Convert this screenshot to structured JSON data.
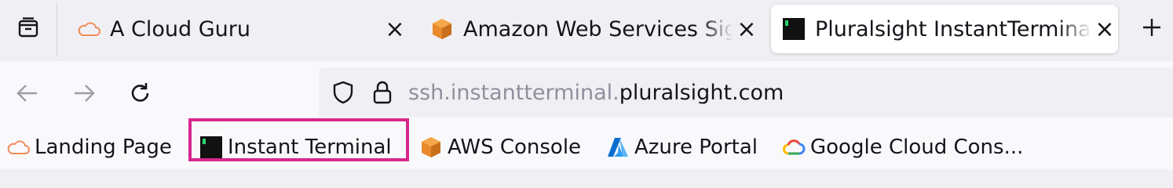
{
  "tabs": [
    {
      "title": "A Cloud Guru",
      "favicon": "cloud-icon",
      "active": false
    },
    {
      "title": "Amazon Web Services Sign-In",
      "favicon": "aws-cube-icon",
      "active": false
    },
    {
      "title": "Pluralsight InstantTerminal",
      "favicon": "terminal-icon",
      "active": true
    }
  ],
  "tab_close_glyph": "×",
  "new_tab_glyph": "+",
  "url": {
    "prefix": "ssh.instantterminal.",
    "domain": "pluralsight.com"
  },
  "bookmarks": [
    {
      "label": "Landing Page",
      "favicon": "cloud-icon"
    },
    {
      "label": "Instant Terminal",
      "favicon": "terminal-icon",
      "highlighted": true
    },
    {
      "label": "AWS Console",
      "favicon": "aws-cube-icon"
    },
    {
      "label": "Azure Portal",
      "favicon": "azure-icon"
    },
    {
      "label": "Google Cloud Cons...",
      "favicon": "google-cloud-icon"
    }
  ],
  "colors": {
    "highlight": "#d6288c",
    "aws_orange": "#e8892b",
    "cloud_orange": "#f08c5a",
    "azure_blue": "#0a6ed1"
  }
}
